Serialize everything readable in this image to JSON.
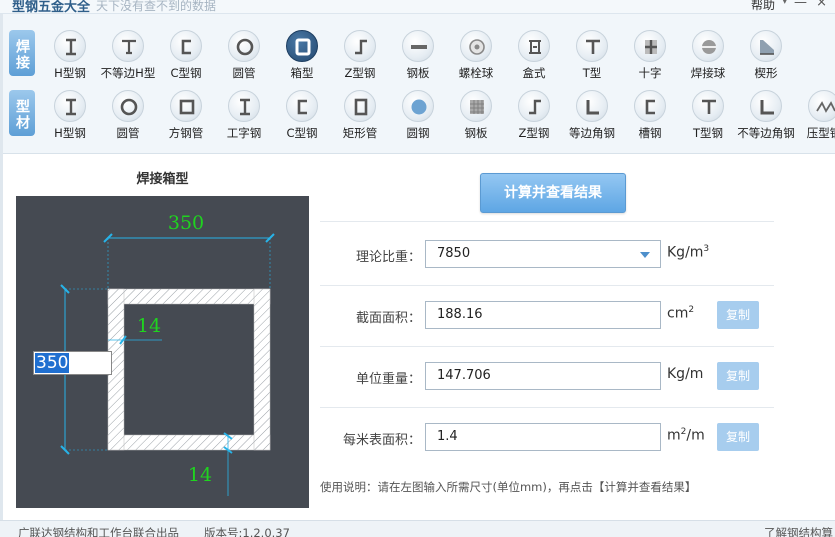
{
  "titlebar": {
    "app_title": "型钢五金大全",
    "slogan": "天下没有查不到的数据",
    "help_label": "帮助",
    "help_caret": "▾",
    "minimize_glyph": "—",
    "close_glyph": "×"
  },
  "ribbon": {
    "weld_group_label": "焊接",
    "profile_group_label": "型材",
    "weld_items": [
      {
        "label": "H型钢",
        "icon": "h-beam-icon"
      },
      {
        "label": "不等边H型",
        "icon": "t-beam-icon"
      },
      {
        "label": "C型钢",
        "icon": "c-channel-icon"
      },
      {
        "label": "圆管",
        "icon": "round-tube-icon"
      },
      {
        "label": "箱型",
        "icon": "box-section-icon",
        "active": true
      },
      {
        "label": "Z型钢",
        "icon": "z-section-icon"
      },
      {
        "label": "钢板",
        "icon": "steel-plate-icon"
      },
      {
        "label": "螺栓球",
        "icon": "bolt-ball-icon"
      },
      {
        "label": "盒式",
        "icon": "box-type-icon"
      },
      {
        "label": "T型",
        "icon": "t-section-icon"
      },
      {
        "label": "十字",
        "icon": "cross-section-icon"
      },
      {
        "label": "焊接球",
        "icon": "welded-ball-icon"
      },
      {
        "label": "楔形",
        "icon": "wedge-icon"
      }
    ],
    "profile_items": [
      {
        "label": "H型钢",
        "icon": "h-beam-icon"
      },
      {
        "label": "圆管",
        "icon": "round-tube-icon"
      },
      {
        "label": "方钢管",
        "icon": "square-tube-icon"
      },
      {
        "label": "工字钢",
        "icon": "i-beam-icon"
      },
      {
        "label": "C型钢",
        "icon": "c-channel-icon"
      },
      {
        "label": "矩形管",
        "icon": "rect-tube-icon"
      },
      {
        "label": "圆钢",
        "icon": "round-bar-icon"
      },
      {
        "label": "钢板",
        "icon": "checker-plate-icon"
      },
      {
        "label": "Z型钢",
        "icon": "z-section-icon"
      },
      {
        "label": "等边角钢",
        "icon": "equal-angle-icon"
      },
      {
        "label": "槽钢",
        "icon": "channel-icon"
      },
      {
        "label": "T型钢",
        "icon": "t-section-icon"
      },
      {
        "label": "不等边角钢",
        "icon": "unequal-angle-icon"
      },
      {
        "label": "压型钢",
        "icon": "profiled-sheet-icon"
      }
    ]
  },
  "drawing": {
    "caption": "焊接箱型",
    "width_value": "350",
    "height_value": "350",
    "web_thickness": "14",
    "flange_thickness": "14"
  },
  "calc_button_label": "计算并查看结果",
  "fields": {
    "density": {
      "label": "理论比重：",
      "value": "7850",
      "unit_base": "Kg/m",
      "unit_sup": "3"
    },
    "area": {
      "label": "截面面积：",
      "value": "188.16",
      "unit_base": "cm",
      "unit_sup": "2",
      "copy_label": "复制"
    },
    "unit_weight": {
      "label": "单位重量：",
      "value": "147.706",
      "unit_base": "Kg/m",
      "copy_label": "复制"
    },
    "surface": {
      "label": "每米表面积：",
      "value": "1.4",
      "unit_base": "m",
      "unit_sup": "2",
      "unit_tail": "/m",
      "copy_label": "复制"
    }
  },
  "usage_note": "使用说明：请在左图输入所需尺寸(单位mm)，再点击【计算并查看结果】",
  "statusbar": {
    "credits": "广联达钢结构和工作台联合出品",
    "version": "版本号:1.2.0.37",
    "link": "了解钢结构算"
  },
  "colors": {
    "accent": "#5ea6e4",
    "canvas_bg": "#454a52",
    "dimension_green": "#1fd41f",
    "dimension_cyan": "#27b3e8"
  }
}
